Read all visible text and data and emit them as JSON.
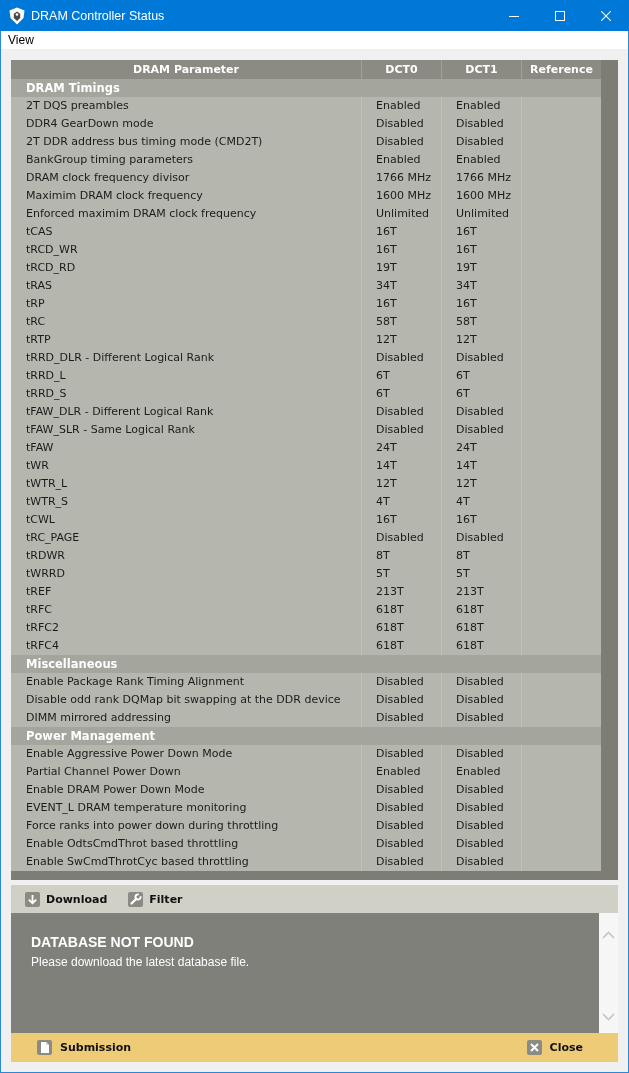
{
  "window": {
    "title": "DRAM Controller Status"
  },
  "menu": [
    {
      "label": "View"
    }
  ],
  "table": {
    "columns": [
      "DRAM Parameter",
      "DCT0",
      "DCT1",
      "Reference"
    ],
    "sections": [
      {
        "title": "DRAM Timings",
        "rows": [
          {
            "parameter": "2T DQS preambles",
            "dct0": "Enabled",
            "dct1": "Enabled"
          },
          {
            "parameter": "DDR4 GearDown mode",
            "dct0": "Disabled",
            "dct1": "Disabled"
          },
          {
            "parameter": "2T DDR address bus timing mode (CMD2T)",
            "dct0": "Disabled",
            "dct1": "Disabled"
          },
          {
            "parameter": "BankGroup timing parameters",
            "dct0": "Enabled",
            "dct1": "Enabled"
          },
          {
            "parameter": "DRAM clock frequency divisor",
            "dct0": "1766 MHz",
            "dct1": "1766 MHz"
          },
          {
            "parameter": "Maximim DRAM clock frequency",
            "dct0": "1600 MHz",
            "dct1": "1600 MHz"
          },
          {
            "parameter": "Enforced maximim DRAM clock frequency",
            "dct0": "Unlimited",
            "dct1": "Unlimited"
          },
          {
            "parameter": "tCAS",
            "dct0": "16T",
            "dct1": "16T"
          },
          {
            "parameter": "tRCD_WR",
            "dct0": "16T",
            "dct1": "16T"
          },
          {
            "parameter": "tRCD_RD",
            "dct0": "19T",
            "dct1": "19T"
          },
          {
            "parameter": "tRAS",
            "dct0": "34T",
            "dct1": "34T"
          },
          {
            "parameter": "tRP",
            "dct0": "16T",
            "dct1": "16T"
          },
          {
            "parameter": "tRC",
            "dct0": "58T",
            "dct1": "58T"
          },
          {
            "parameter": "tRTP",
            "dct0": "12T",
            "dct1": "12T"
          },
          {
            "parameter": "tRRD_DLR - Different Logical Rank",
            "dct0": "Disabled",
            "dct1": "Disabled"
          },
          {
            "parameter": "tRRD_L",
            "dct0": "6T",
            "dct1": "6T"
          },
          {
            "parameter": "tRRD_S",
            "dct0": "6T",
            "dct1": "6T"
          },
          {
            "parameter": "tFAW_DLR - Different Logical Rank",
            "dct0": "Disabled",
            "dct1": "Disabled"
          },
          {
            "parameter": "tFAW_SLR - Same Logical Rank",
            "dct0": "Disabled",
            "dct1": "Disabled"
          },
          {
            "parameter": "tFAW",
            "dct0": "24T",
            "dct1": "24T"
          },
          {
            "parameter": "tWR",
            "dct0": "14T",
            "dct1": "14T"
          },
          {
            "parameter": "tWTR_L",
            "dct0": "12T",
            "dct1": "12T"
          },
          {
            "parameter": "tWTR_S",
            "dct0": "4T",
            "dct1": "4T"
          },
          {
            "parameter": "tCWL",
            "dct0": "16T",
            "dct1": "16T"
          },
          {
            "parameter": "tRC_PAGE",
            "dct0": "Disabled",
            "dct1": "Disabled"
          },
          {
            "parameter": "tRDWR",
            "dct0": "8T",
            "dct1": "8T"
          },
          {
            "parameter": "tWRRD",
            "dct0": "5T",
            "dct1": "5T"
          },
          {
            "parameter": "tREF",
            "dct0": "213T",
            "dct1": "213T"
          },
          {
            "parameter": "tRFC",
            "dct0": "618T",
            "dct1": "618T"
          },
          {
            "parameter": "tRFC2",
            "dct0": "618T",
            "dct1": "618T"
          },
          {
            "parameter": "tRFC4",
            "dct0": "618T",
            "dct1": "618T"
          }
        ]
      },
      {
        "title": "Miscellaneous",
        "rows": [
          {
            "parameter": "Enable Package Rank Timing Alignment",
            "dct0": "Disabled",
            "dct1": "Disabled"
          },
          {
            "parameter": "Disable odd rank DQMap bit swapping at the DDR device",
            "dct0": "Disabled",
            "dct1": "Disabled"
          },
          {
            "parameter": "DIMM mirrored addressing",
            "dct0": "Disabled",
            "dct1": "Disabled"
          }
        ]
      },
      {
        "title": "Power Management",
        "rows": [
          {
            "parameter": "Enable Aggressive Power Down Mode",
            "dct0": "Disabled",
            "dct1": "Disabled"
          },
          {
            "parameter": "Partial Channel Power Down",
            "dct0": "Enabled",
            "dct1": "Enabled"
          },
          {
            "parameter": "Enable DRAM Power Down Mode",
            "dct0": "Disabled",
            "dct1": "Disabled"
          },
          {
            "parameter": "EVENT_L DRAM temperature monitoring",
            "dct0": "Disabled",
            "dct1": "Disabled"
          },
          {
            "parameter": "Force ranks into power down during throttling",
            "dct0": "Disabled",
            "dct1": "Disabled"
          },
          {
            "parameter": "Enable OdtsCmdThrot based throttling",
            "dct0": "Disabled",
            "dct1": "Disabled"
          },
          {
            "parameter": "Enable SwCmdThrotCyc based throttling",
            "dct0": "Disabled",
            "dct1": "Disabled"
          }
        ]
      }
    ]
  },
  "toolbar": [
    {
      "kind": "download",
      "label": "Download"
    },
    {
      "kind": "filter",
      "label": "Filter"
    }
  ],
  "message": {
    "title": "DATABASE NOT FOUND",
    "text": "Please download the latest database file."
  },
  "footer": [
    {
      "kind": "submission",
      "label": "Submission"
    },
    {
      "kind": "close",
      "label": "Close"
    }
  ]
}
